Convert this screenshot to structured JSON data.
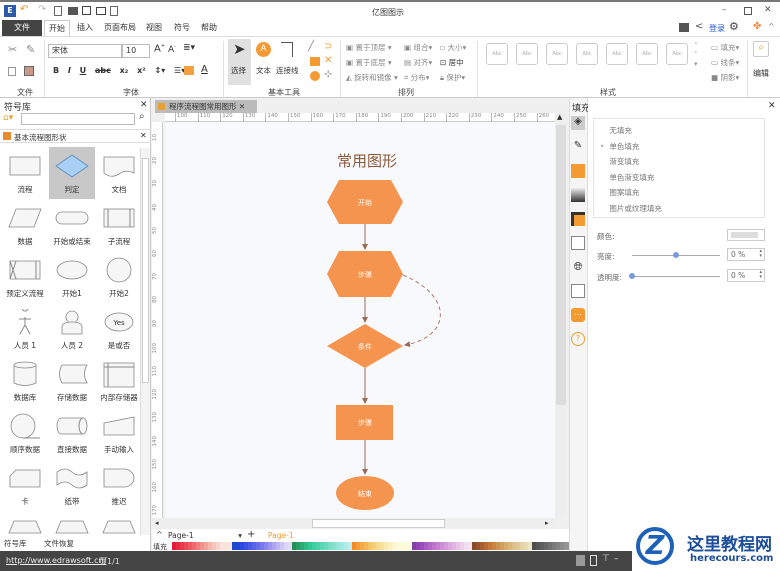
{
  "app": {
    "title": "亿图图示"
  },
  "tabs": [
    {
      "label": "文件"
    },
    {
      "label": "开始"
    },
    {
      "label": "插入"
    },
    {
      "label": "页面布局"
    },
    {
      "label": "视图"
    },
    {
      "label": "符号"
    },
    {
      "label": "帮助"
    }
  ],
  "account": {
    "login": "登录"
  },
  "ribbon": {
    "groups": {
      "file": "文件",
      "font": "字体",
      "tools": "基本工具",
      "arrange": "排列",
      "style": "样式",
      "edit": "编辑"
    },
    "font_name": "宋体",
    "font_size": "10",
    "tools": {
      "select": "选择",
      "text": "文本",
      "connector": "连接线"
    },
    "arrange": {
      "front": "置于顶层",
      "back": "置于底层",
      "rotate": "旋转和镜像",
      "group": "组合",
      "align": "对齐",
      "distribute": "分布",
      "size": "大小",
      "center": "居中",
      "protect": "保护"
    },
    "style_thumb": "Abc",
    "style": {
      "fill": "填充",
      "line": "线条",
      "shadow": "阴影"
    }
  },
  "library": {
    "title": "符号库",
    "search_placeholder": "",
    "category": "基本流程图形状",
    "shapes": [
      {
        "label": "流程"
      },
      {
        "label": "判定"
      },
      {
        "label": "文档"
      },
      {
        "label": "数据"
      },
      {
        "label": "开始或结束"
      },
      {
        "label": "子流程"
      },
      {
        "label": "预定义流程"
      },
      {
        "label": "开始1"
      },
      {
        "label": "开始2"
      },
      {
        "label": "人员 1"
      },
      {
        "label": "人员 2"
      },
      {
        "label": "是或否"
      },
      {
        "label": "数据库"
      },
      {
        "label": "存储数据"
      },
      {
        "label": "内部存储器"
      },
      {
        "label": "顺序数据"
      },
      {
        "label": "直接数据"
      },
      {
        "label": "手动输入"
      },
      {
        "label": "卡"
      },
      {
        "label": "纸带"
      },
      {
        "label": "推迟"
      }
    ],
    "yes_text": "Yes",
    "bottom_tabs": [
      "符号库",
      "文件恢复"
    ]
  },
  "document": {
    "tab": "程序流程图常用图形",
    "ruler_h": [
      "100",
      "110",
      "120",
      "130",
      "140",
      "150",
      "160",
      "170",
      "180",
      "190",
      "200",
      "210",
      "220",
      "230",
      "240",
      "250",
      "260"
    ],
    "ruler_v": [
      "10",
      "20",
      "30",
      "40",
      "50",
      "60",
      "70",
      "80",
      "90",
      "100",
      "110",
      "120",
      "130",
      "140",
      "150",
      "160",
      "170"
    ],
    "diagram": {
      "title": "常用图形",
      "nodes": [
        "开始",
        "步骤",
        "条件",
        "步骤",
        "结束"
      ],
      "color": "#f4944f"
    },
    "page_select": "Page-1",
    "page_tab": "Page-1",
    "palette_label": "填充"
  },
  "fill_panel": {
    "title": "填充",
    "options": [
      "无填充",
      "单色填充",
      "渐变填充",
      "单色渐变填充",
      "图案填充",
      "图片或纹理填充"
    ],
    "selected": 1,
    "color_label": "颜色:",
    "brightness_label": "亮度:",
    "brightness_value": "0 %",
    "brightness": 0.5,
    "transparency_label": "透明度:",
    "transparency_value": "0 %",
    "transparency": 0
  },
  "status": {
    "url": "http://www.edrawsoft.cn/",
    "page": "页1/1"
  },
  "watermark": {
    "name": "这里教程网",
    "url": "herecours.com"
  }
}
